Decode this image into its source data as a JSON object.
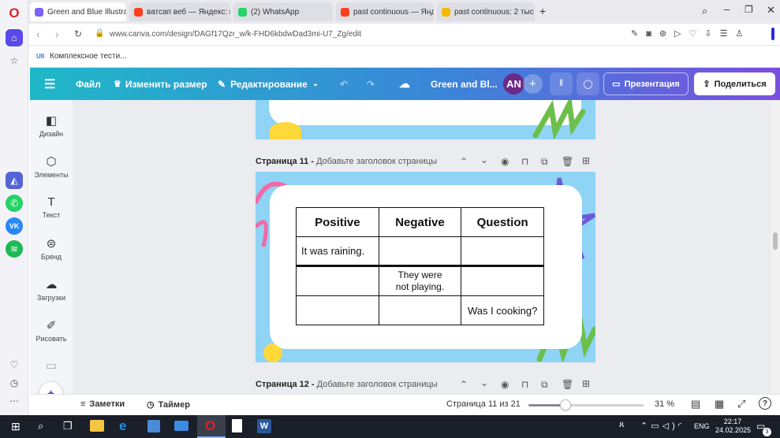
{
  "browser": {
    "tabs": [
      {
        "label": "Green and Blue Illustrative",
        "active": true,
        "color": "#7b61ff"
      },
      {
        "label": "ватсап веб — Яндекс: на",
        "active": false,
        "color": "#fc3f1d"
      },
      {
        "label": "(2) WhatsApp",
        "active": false,
        "color": "#25d366"
      },
      {
        "label": "past continuous — Янде",
        "active": false,
        "color": "#fc3f1d"
      },
      {
        "label": "past continuous: 2 тыс изо",
        "active": false,
        "color": "#f5b800"
      }
    ],
    "url": "www.canva.com/design/DAGf17Qzr_w/k-FHD6kbdwDad3mi-U7_Zg/edit",
    "bookmark": "Комплексное тести..."
  },
  "canva_top": {
    "file": "Файл",
    "resize": "Изменить размер",
    "edit": "Редактирование",
    "title": "Green and Bl...",
    "avatar": "AN",
    "present": "Презентация",
    "share": "Поделиться"
  },
  "left_panel": {
    "items": [
      {
        "label": "Дизайн",
        "icon": "design-icon"
      },
      {
        "label": "Элементы",
        "icon": "elements-icon"
      },
      {
        "label": "Текст",
        "icon": "text-icon"
      },
      {
        "label": "Бренд",
        "icon": "brand-icon"
      },
      {
        "label": "Загрузки",
        "icon": "upload-icon"
      },
      {
        "label": "Рисовать",
        "icon": "draw-icon"
      }
    ]
  },
  "page11": {
    "label": "Страница 11 - ",
    "placeholder": "Добавьте заголовок страницы",
    "table": {
      "headers": [
        "Positive",
        "Negative",
        "Question"
      ],
      "rows": [
        [
          "It was raining.",
          "",
          ""
        ],
        [
          "",
          "They were not playing.",
          ""
        ],
        [
          "",
          "",
          "Was I cooking?"
        ]
      ]
    }
  },
  "page12": {
    "label": "Страница 12 - ",
    "placeholder": "Добавьте заголовок страницы"
  },
  "bottom": {
    "notes": "Заметки",
    "timer": "Таймер",
    "page_indicator": "Страница 11 из 21",
    "zoom": "31 %",
    "zoom_level": 0.31
  },
  "taskbar": {
    "lang": "ENG",
    "time": "22:17",
    "date": "24.02.2025",
    "notif": "3"
  }
}
